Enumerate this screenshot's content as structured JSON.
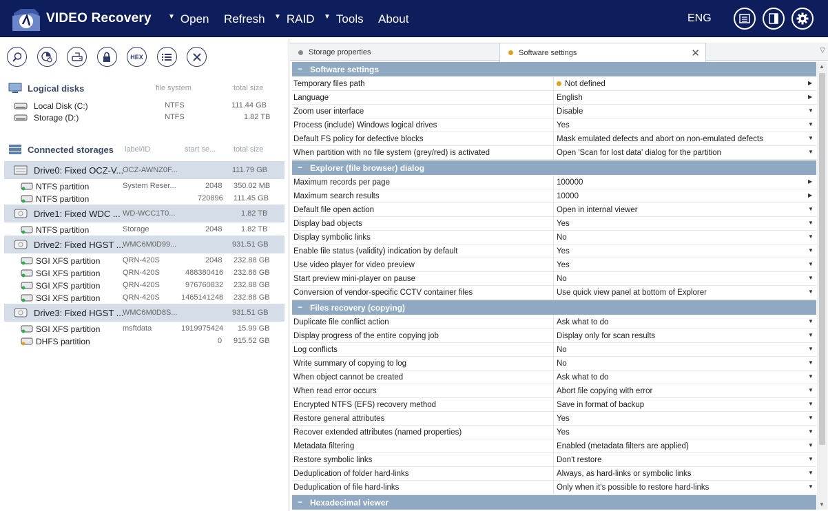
{
  "app": {
    "title": "VIDEO Recovery",
    "menu": [
      {
        "label": "Open",
        "has_arrow": true
      },
      {
        "label": "Refresh",
        "has_arrow": false
      },
      {
        "label": "RAID",
        "has_arrow": true
      },
      {
        "label": "Tools",
        "has_arrow": true
      },
      {
        "label": "About",
        "has_arrow": false
      }
    ],
    "language": "ENG"
  },
  "toolbar": {
    "hex_label": "HEX"
  },
  "logical_disks": {
    "title": "Logical disks",
    "col_fs": "file system",
    "col_size": "total size",
    "items": [
      {
        "name": "Local Disk (C:)",
        "fs": "NTFS",
        "size": "111.44 GB"
      },
      {
        "name": "Storage (D:)",
        "fs": "NTFS",
        "size": "1.82 TB"
      }
    ]
  },
  "connected_storages": {
    "title": "Connected storages",
    "col_label": "label/ID",
    "col_start": "start se...",
    "col_size": "total size",
    "drives": [
      {
        "name": "Drive0: Fixed OCZ-V...",
        "id": "OCZ-AWNZ0F...",
        "size": "111.79 GB",
        "partitions": [
          {
            "name": "NTFS partition",
            "label": "System Reser...",
            "start": "2048",
            "size": "350.02 MB"
          },
          {
            "name": "NTFS partition",
            "label": "",
            "start": "720896",
            "size": "111.45 GB"
          }
        ]
      },
      {
        "name": "Drive1: Fixed WDC ...",
        "id": "WD-WCC1T0...",
        "size": "1.82 TB",
        "partitions": [
          {
            "name": "NTFS partition",
            "label": "Storage",
            "start": "2048",
            "size": "1.82 TB"
          }
        ]
      },
      {
        "name": "Drive2: Fixed HGST ...",
        "id": "WMC6M0D99...",
        "size": "931.51 GB",
        "partitions": [
          {
            "name": "SGI XFS partition",
            "label": "QRN-420S",
            "start": "2048",
            "size": "232.88 GB"
          },
          {
            "name": "SGI XFS partition",
            "label": "QRN-420S",
            "start": "488380416",
            "size": "232.88 GB"
          },
          {
            "name": "SGI XFS partition",
            "label": "QRN-420S",
            "start": "976760832",
            "size": "232.88 GB"
          },
          {
            "name": "SGI XFS partition",
            "label": "QRN-420S",
            "start": "1465141248",
            "size": "232.88 GB"
          }
        ]
      },
      {
        "name": "Drive3: Fixed HGST ...",
        "id": "WMC6M0D8S...",
        "size": "931.51 GB",
        "partitions": [
          {
            "name": "SGI XFS partition",
            "label": "msftdata",
            "start": "1919975424",
            "size": "15.99 GB"
          },
          {
            "name": "DHFS partition",
            "label": "",
            "start": "0",
            "size": "915.52 GB"
          }
        ]
      }
    ]
  },
  "tabs": [
    {
      "label": "Storage properties",
      "active": false,
      "dot_color": "#888888"
    },
    {
      "label": "Software settings",
      "active": true,
      "dot_color": "#e0a020"
    }
  ],
  "settings": [
    {
      "group": "Software settings",
      "rows": [
        {
          "k": "Temporary files path",
          "v": "Not defined",
          "ctl": "arrow",
          "dot": true
        },
        {
          "k": "Language",
          "v": "English",
          "ctl": "arrow"
        },
        {
          "k": "Zoom user interface",
          "v": "Disable",
          "ctl": "down"
        },
        {
          "k": "Process (include) Windows logical drives",
          "v": "Yes",
          "ctl": "down"
        },
        {
          "k": "Default FS policy for defective blocks",
          "v": "Mask emulated defects and abort on non-emulated defects",
          "ctl": "down"
        },
        {
          "k": "When partition with no file system (grey/red) is activated",
          "v": "Open 'Scan for lost data' dialog for the partition",
          "ctl": "down"
        }
      ]
    },
    {
      "group": "Explorer (file browser) dialog",
      "rows": [
        {
          "k": "Maximum records per page",
          "v": "100000",
          "ctl": "arrow"
        },
        {
          "k": "Maximum search results",
          "v": "10000",
          "ctl": "arrow"
        },
        {
          "k": "Default file open action",
          "v": "Open in internal viewer",
          "ctl": "down"
        },
        {
          "k": "Display bad objects",
          "v": "Yes",
          "ctl": "down"
        },
        {
          "k": "Display symbolic links",
          "v": "No",
          "ctl": "down"
        },
        {
          "k": "Enable file status (validity) indication by default",
          "v": "Yes",
          "ctl": "down"
        },
        {
          "k": "Use video player for video preview",
          "v": "Yes",
          "ctl": "down"
        },
        {
          "k": "Start preview mini-player on pause",
          "v": "No",
          "ctl": "down"
        },
        {
          "k": "Conversion of vendor-specific CCTV container files",
          "v": "Use quick view panel at bottom of Explorer",
          "ctl": "down"
        }
      ]
    },
    {
      "group": "Files recovery (copying)",
      "rows": [
        {
          "k": "Duplicate file conflict action",
          "v": "Ask what to do",
          "ctl": "down"
        },
        {
          "k": "Display progress of the entire copying job",
          "v": "Display only for scan results",
          "ctl": "down"
        },
        {
          "k": "Log conflicts",
          "v": "No",
          "ctl": "down"
        },
        {
          "k": "Write summary of copying to log",
          "v": "No",
          "ctl": "down"
        },
        {
          "k": "When object cannot be created",
          "v": "Ask what to do",
          "ctl": "down"
        },
        {
          "k": "When read error occurs",
          "v": "Abort file copying with error",
          "ctl": "down"
        },
        {
          "k": "Encrypted NTFS (EFS) recovery method",
          "v": "Save in format of backup",
          "ctl": "down"
        },
        {
          "k": "Restore general attributes",
          "v": "Yes",
          "ctl": "down"
        },
        {
          "k": "Recover extended attributes (named properties)",
          "v": "Yes",
          "ctl": "down"
        },
        {
          "k": "Metadata filtering",
          "v": "Enabled (metadata filters are applied)",
          "ctl": "down"
        },
        {
          "k": "Restore symbolic links",
          "v": "Don't restore",
          "ctl": "down"
        },
        {
          "k": "Deduplication of folder hard-links",
          "v": "Always, as hard-links or symbolic links",
          "ctl": "down"
        },
        {
          "k": "Deduplication of file hard-links",
          "v": "Only when it's possible to restore hard-links",
          "ctl": "down"
        }
      ]
    },
    {
      "group": "Hexadecimal viewer",
      "rows": []
    }
  ]
}
